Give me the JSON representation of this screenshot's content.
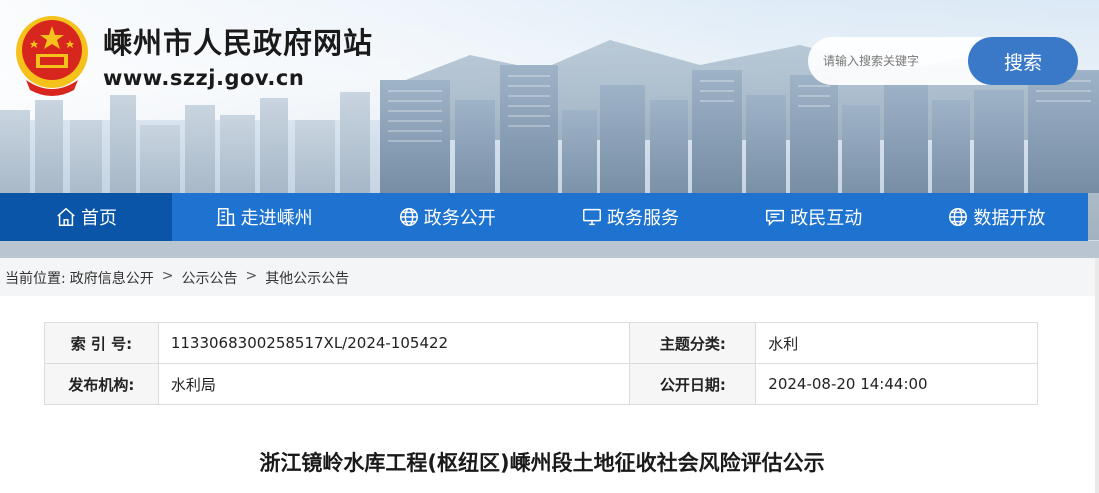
{
  "header": {
    "site_title": "嵊州市人民政府网站",
    "site_url": "www.szzj.gov.cn",
    "search_placeholder": "请输入搜索关键字",
    "search_button": "搜索"
  },
  "nav": {
    "items": [
      {
        "label": "首页",
        "icon": "home-icon"
      },
      {
        "label": "走进嵊州",
        "icon": "building-icon"
      },
      {
        "label": "政务公开",
        "icon": "globe-icon"
      },
      {
        "label": "政务服务",
        "icon": "monitor-icon"
      },
      {
        "label": "政民互动",
        "icon": "chat-icon"
      },
      {
        "label": "数据开放",
        "icon": "globe-icon"
      }
    ]
  },
  "breadcrumb": {
    "prefix": "当前位置:",
    "items": [
      "政府信息公开",
      "公示公告",
      "其他公示公告"
    ],
    "separator": ">"
  },
  "meta": {
    "index_label": "索 引 号:",
    "index_value": "1133068300258517XL/2024-105422",
    "topic_label": "主题分类:",
    "topic_value": "水利",
    "publisher_label": "发布机构:",
    "publisher_value": "水利局",
    "date_label": "公开日期:",
    "date_value": "2024-08-20 14:44:00"
  },
  "article": {
    "title": "浙江镜岭水库工程(枢纽区)嵊州段土地征收社会风险评估公示"
  },
  "colors": {
    "nav_bg": "#1f73d0",
    "nav_active": "#0b55a8",
    "search_button": "#3a78c8",
    "emblem_red": "#d7261e",
    "emblem_gold": "#f4c21a"
  }
}
